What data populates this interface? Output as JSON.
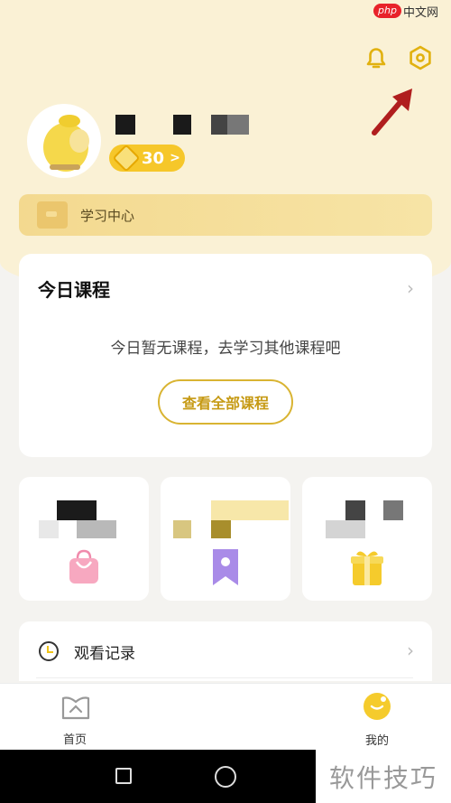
{
  "watermark_top": {
    "badge": "php",
    "text": "中文网"
  },
  "profile": {
    "coins": "30",
    "coins_arrow": ">"
  },
  "study_center": {
    "label": "学习中心"
  },
  "today_course": {
    "title": "今日课程",
    "chevron": "›",
    "empty_text": "今日暂无课程，去学习其他课程吧",
    "view_all_label": "查看全部课程"
  },
  "watch_history": {
    "label": "观看记录",
    "chevron": "›"
  },
  "tabbar": {
    "home_label": "首页",
    "mine_label": "我的"
  },
  "watermark_bottom": {
    "text": "软件技巧"
  },
  "colors": {
    "accent": "#f6c72a",
    "header_bg": "#faf1d5",
    "arrow_annotation": "#b01e1e"
  }
}
